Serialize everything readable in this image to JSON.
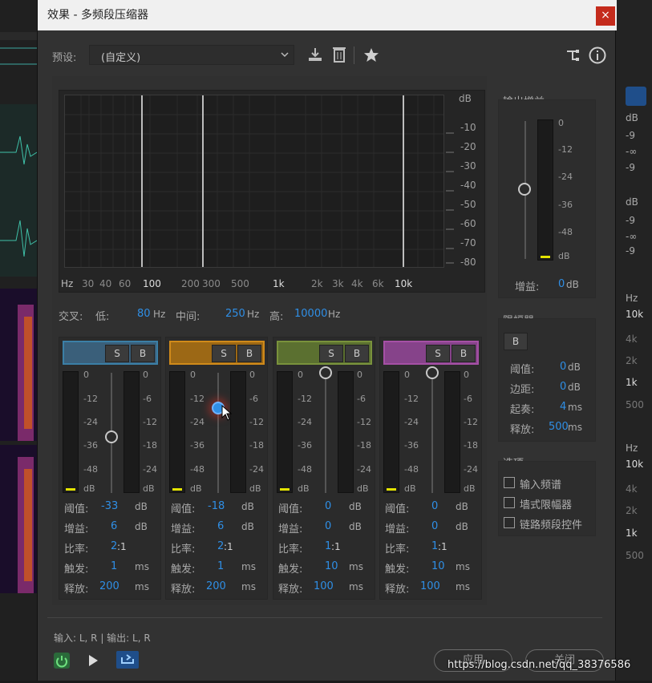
{
  "window": {
    "title": "效果 - 多频段压缩器",
    "close": "×"
  },
  "toolbar": {
    "preset_label": "预设:",
    "preset_value": "(自定义)"
  },
  "graph": {
    "db_unit": "dB",
    "db_ticks": [
      "-10",
      "-20",
      "-30",
      "-40",
      "-50",
      "-60",
      "-70",
      "-80"
    ],
    "hz_ticks": [
      "Hz",
      "30",
      "40",
      "60",
      "100",
      "200",
      "300",
      "500",
      "1k",
      "2k",
      "3k",
      "4k",
      "6k",
      "10k"
    ]
  },
  "crossover": {
    "label": "交叉:",
    "low_label": "低:",
    "low_value": "80",
    "mid_label": "中间:",
    "mid_value": "250",
    "high_label": "高:",
    "high_value": "10000",
    "unit": "Hz"
  },
  "output": {
    "title": "输出增益",
    "scale": [
      "0",
      "-12",
      "-24",
      "-36",
      "-48",
      "dB"
    ],
    "gain_label": "增益:",
    "gain_value": "0",
    "gain_unit": "dB"
  },
  "limiter": {
    "title": "限幅器",
    "bypass": "B",
    "threshold_label": "阈值:",
    "threshold_value": "0",
    "threshold_unit": "dB",
    "margin_label": "边距:",
    "margin_value": "0",
    "margin_unit": "dB",
    "attack_label": "起奏:",
    "attack_value": "4",
    "attack_unit": "ms",
    "release_label": "释放:",
    "release_value": "500",
    "release_unit": "ms"
  },
  "options": {
    "title": "选项",
    "items": [
      "输入频谱",
      "墙式限幅器",
      "链路频段控件"
    ]
  },
  "band_labels": {
    "solo": "S",
    "bypass": "B",
    "threshold": "阈值:",
    "gain": "增益:",
    "ratio": "比率:",
    "attack": "触发:",
    "release": "释放:",
    "db": "dB",
    "ms": "ms"
  },
  "meter_scale": [
    "0",
    "-12",
    "-24",
    "-36",
    "-48",
    "dB"
  ],
  "bands": [
    {
      "color": "#3b7fa6",
      "fill": "#3a5f7a",
      "gain_scale": [
        "0",
        "-6",
        "-12",
        "-18",
        "-24",
        "dB"
      ],
      "threshold": "-33",
      "gain": "6",
      "ratio": "2",
      "ratio_suffix": ":1",
      "attack": "1",
      "release": "200"
    },
    {
      "color": "#d08a1a",
      "fill": "#9c6815",
      "gain_scale": [
        "0",
        "-6",
        "-12",
        "-18",
        "-24",
        "dB"
      ],
      "threshold": "-18",
      "gain": "6",
      "ratio": "2",
      "ratio_suffix": ":1",
      "attack": "1",
      "release": "200"
    },
    {
      "color": "#79923c",
      "fill": "#5b7030",
      "gain_scale": [
        "0",
        "-6",
        "-12",
        "-18",
        "-24",
        "dB"
      ],
      "threshold": "0",
      "gain": "0",
      "ratio": "1",
      "ratio_suffix": ":1",
      "attack": "10",
      "release": "100"
    },
    {
      "color": "#a550a5",
      "fill": "#86438a",
      "gain_scale": [
        "0",
        "-6",
        "-12",
        "-18",
        "-24",
        "dB"
      ],
      "threshold": "0",
      "gain": "0",
      "ratio": "1",
      "ratio_suffix": ":1",
      "attack": "10",
      "release": "100"
    }
  ],
  "io": {
    "text": "输入: L, R | 输出: L, R"
  },
  "footer": {
    "apply": "应用",
    "close": "关闭",
    "watermark": "https://blog.csdn.net/qq_38376586"
  },
  "side_right": {
    "db": "dB",
    "v1": "-9",
    "inf": "-∞",
    "v2": "-9",
    "hz": "Hz",
    "k10": "10k",
    "k4": "4k",
    "k2": "2k",
    "k1": "1k",
    "h500": "500"
  }
}
